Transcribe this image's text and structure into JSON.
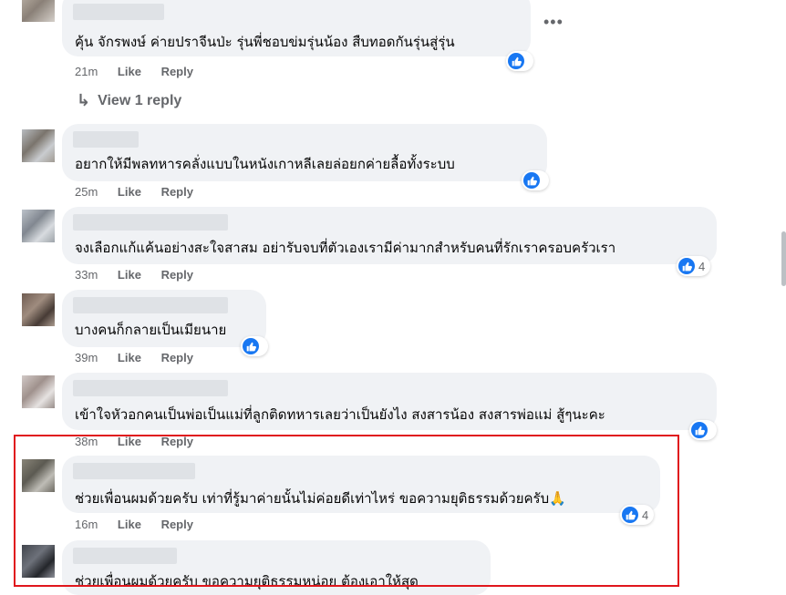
{
  "colors": {
    "like_blue": "#1877f2",
    "highlight_red": "#e0161c",
    "bubble_bg": "#f0f2f5",
    "meta_gray": "#65676b"
  },
  "more_button": "•••",
  "comments": [
    {
      "text": "คุ้น จักรพงษ์ ค่ายปราจีนป่ะ รุ่นพี่ชอบข่มรุ่นน้อง สืบทอดกันรุ่นสู่รุ่น",
      "time": "21m",
      "like": "Like",
      "reply": "Reply",
      "reaction_count": ""
    },
    {
      "text": "อยากให้มีพลทหารคลั่งแบบในหนังเกาหลีเลยล่อยกค่ายลื้อทั้งระบบ",
      "time": "25m",
      "like": "Like",
      "reply": "Reply",
      "reaction_count": ""
    },
    {
      "text": "จงเลือกแก้แค้นอย่างสะใจสาสม อย่ารับจบที่ตัวเองเรามีค่ามากสำหรับคนที่รักเราครอบครัวเรา",
      "time": "33m",
      "like": "Like",
      "reply": "Reply",
      "reaction_count": "4"
    },
    {
      "text": "บางคนก็กลายเป็นเมียนาย",
      "time": "39m",
      "like": "Like",
      "reply": "Reply",
      "reaction_count": ""
    },
    {
      "text": "เข้าใจหัวอกคนเป็นพ่อเป็นแม่ที่ลูกติดทหารเลยว่าเป็นยังไง สงสารน้อง สงสารพ่อแม่ สู้ๆนะคะ",
      "time": "38m",
      "like": "Like",
      "reply": "Reply",
      "reaction_count": ""
    },
    {
      "text": "ช่วยเพื่อนผมด้วยครับ เท่าที่รู้มาค่ายนั้นไม่ค่อยดีเท่าไหร่ ขอความยุติธรรมด้วยครับ🙏",
      "time": "16m",
      "like": "Like",
      "reply": "Reply",
      "reaction_count": "4"
    },
    {
      "text": "ช่วยเพื่อนผมด้วยครับ ขอความยุติธรรมหน่อย ต้องเอาให้สุด",
      "time": "",
      "like": "",
      "reply": "",
      "reaction_count": ""
    }
  ],
  "view_replies": "View 1 reply"
}
